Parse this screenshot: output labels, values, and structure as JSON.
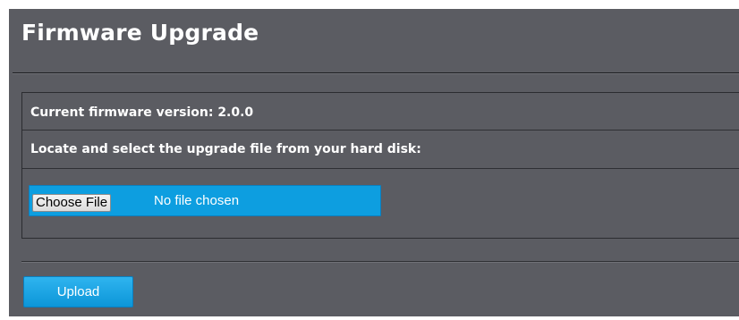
{
  "page": {
    "title": "Firmware Upgrade"
  },
  "firmware": {
    "current_version_label": "Current firmware version: 2.0.0",
    "locate_instruction": "Locate and select the upgrade file from your hard disk:"
  },
  "file_input": {
    "button_label": "Choose File",
    "status_text": "No file chosen"
  },
  "actions": {
    "upload_label": "Upload"
  },
  "colors": {
    "background": "#5b5c62",
    "accent": "#0d9ee0",
    "text": "#ffffff"
  }
}
